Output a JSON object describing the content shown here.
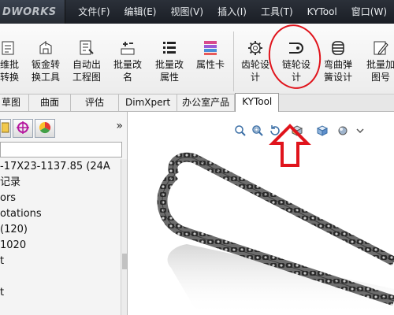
{
  "app": {
    "logo_text": "DWORKS"
  },
  "menu": [
    "文件(F)",
    "编辑(E)",
    "视图(V)",
    "插入(I)",
    "工具(T)",
    "KYTool",
    "窗口(W)"
  ],
  "ribbon": {
    "tools": [
      {
        "label": "维批\n转换",
        "icon": "batch-convert-icon"
      },
      {
        "label": "钣金转\n换工具",
        "icon": "sheet-metal-convert-icon"
      },
      {
        "label": "自动出\n工程图",
        "icon": "auto-drawing-icon"
      },
      {
        "label": "批量改\n名",
        "icon": "batch-rename-icon"
      },
      {
        "label": "批量改\n属性",
        "icon": "batch-properties-icon"
      },
      {
        "label": "属性卡",
        "icon": "property-card-icon"
      },
      {
        "label": "齿轮设\n计",
        "icon": "gear-icon"
      },
      {
        "label": "链轮设\n计",
        "icon": "sprocket-icon"
      },
      {
        "label": "弯曲弹\n簧设计",
        "icon": "spring-icon"
      },
      {
        "label": "批量加\n图号",
        "icon": "drawing-number-icon"
      }
    ],
    "highlight_color": "#e0141c"
  },
  "tabs": [
    {
      "label": "草图",
      "active": false
    },
    {
      "label": "曲面",
      "active": false
    },
    {
      "label": "评估",
      "active": false
    },
    {
      "label": "DimXpert",
      "active": false
    },
    {
      "label": "办公室产品",
      "active": false
    },
    {
      "label": "KYTool",
      "active": true
    }
  ],
  "feature_panel": {
    "tab_icons": [
      "feature-manager-icon",
      "dimxpert-icon",
      "appearance-icon"
    ],
    "expand_glyph": "»",
    "tree": [
      "-17X23-1137.85  (24A",
      "记录",
      "ors",
      "otations",
      "(120)",
      "1020",
      "t",
      "",
      "t"
    ]
  },
  "view_toolbar": {
    "icons": [
      "zoom-to-fit-icon",
      "zoom-area-icon",
      "previous-view-icon",
      "section-view-icon",
      "view-orientation-icon",
      "display-style-icon",
      "more-icon"
    ]
  }
}
